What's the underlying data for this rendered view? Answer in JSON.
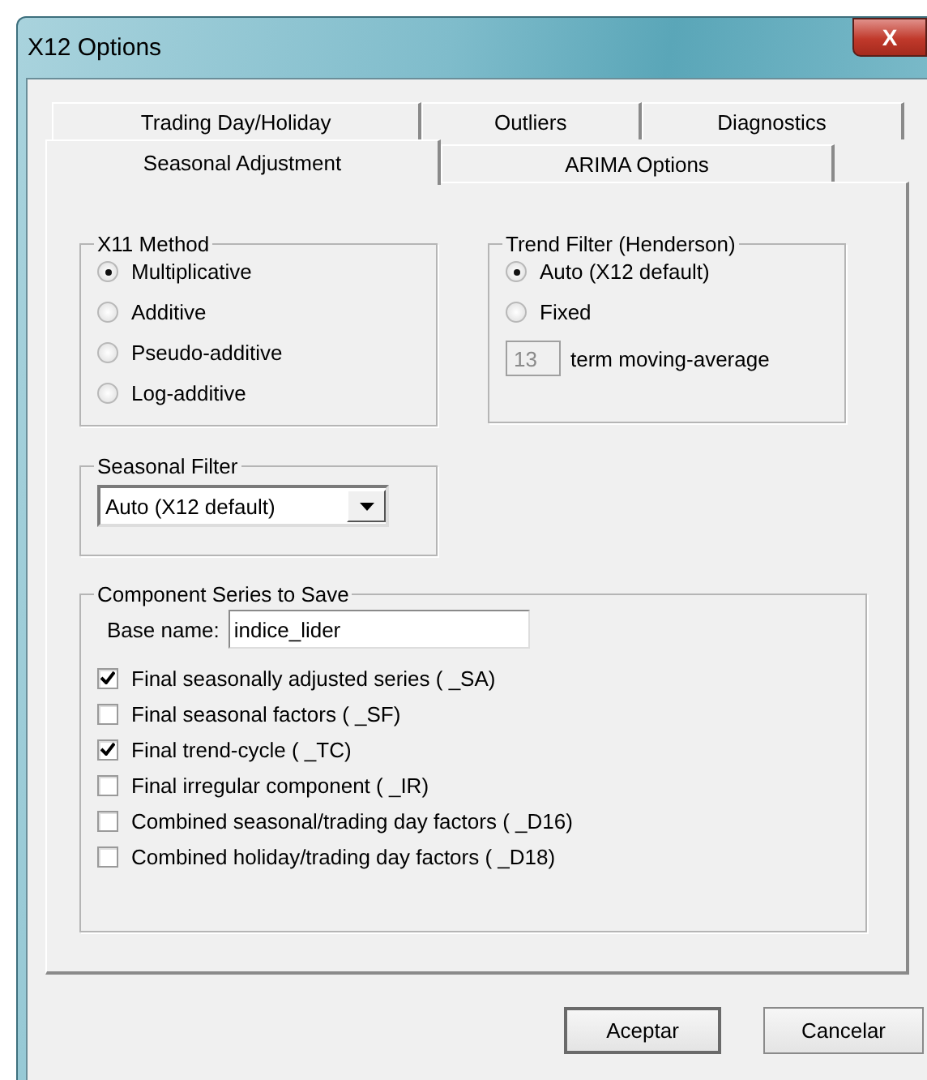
{
  "window": {
    "title": "X12 Options",
    "close": "X"
  },
  "tab_rows": [
    [
      {
        "label": "Trading Day/Holiday",
        "selected": false
      },
      {
        "label": "Outliers",
        "selected": false
      },
      {
        "label": "Diagnostics",
        "selected": false
      }
    ],
    [
      {
        "label": "Seasonal Adjustment",
        "selected": true
      },
      {
        "label": "ARIMA Options",
        "selected": false
      }
    ]
  ],
  "x11_method": {
    "title": "X11 Method",
    "options": [
      {
        "label": "Multiplicative",
        "selected": true
      },
      {
        "label": "Additive",
        "selected": false
      },
      {
        "label": "Pseudo-additive",
        "selected": false
      },
      {
        "label": "Log-additive",
        "selected": false
      }
    ]
  },
  "trend_filter": {
    "title": "Trend Filter (Henderson)",
    "options": [
      {
        "label": "Auto (X12 default)",
        "selected": true
      },
      {
        "label": "Fixed",
        "selected": false
      }
    ],
    "term": {
      "value": "13",
      "label": "term moving-average",
      "disabled": true
    }
  },
  "seasonal_filter": {
    "title": "Seasonal Filter",
    "value": "Auto (X12 default)"
  },
  "component_series": {
    "title": "Component Series to Save",
    "base_name": {
      "label": "Base name:",
      "value": "indice_lider"
    },
    "items": [
      {
        "label": "Final seasonally adjusted series ( _SA)",
        "checked": true
      },
      {
        "label": "Final seasonal factors ( _SF)",
        "checked": false
      },
      {
        "label": "Final trend-cycle ( _TC)",
        "checked": true
      },
      {
        "label": "Final irregular component ( _IR)",
        "checked": false
      },
      {
        "label": "Combined seasonal/trading day factors ( _D16)",
        "checked": false
      },
      {
        "label": "Combined holiday/trading day factors ( _D18)",
        "checked": false
      }
    ]
  },
  "buttons": [
    "Aceptar",
    "Cancelar"
  ]
}
